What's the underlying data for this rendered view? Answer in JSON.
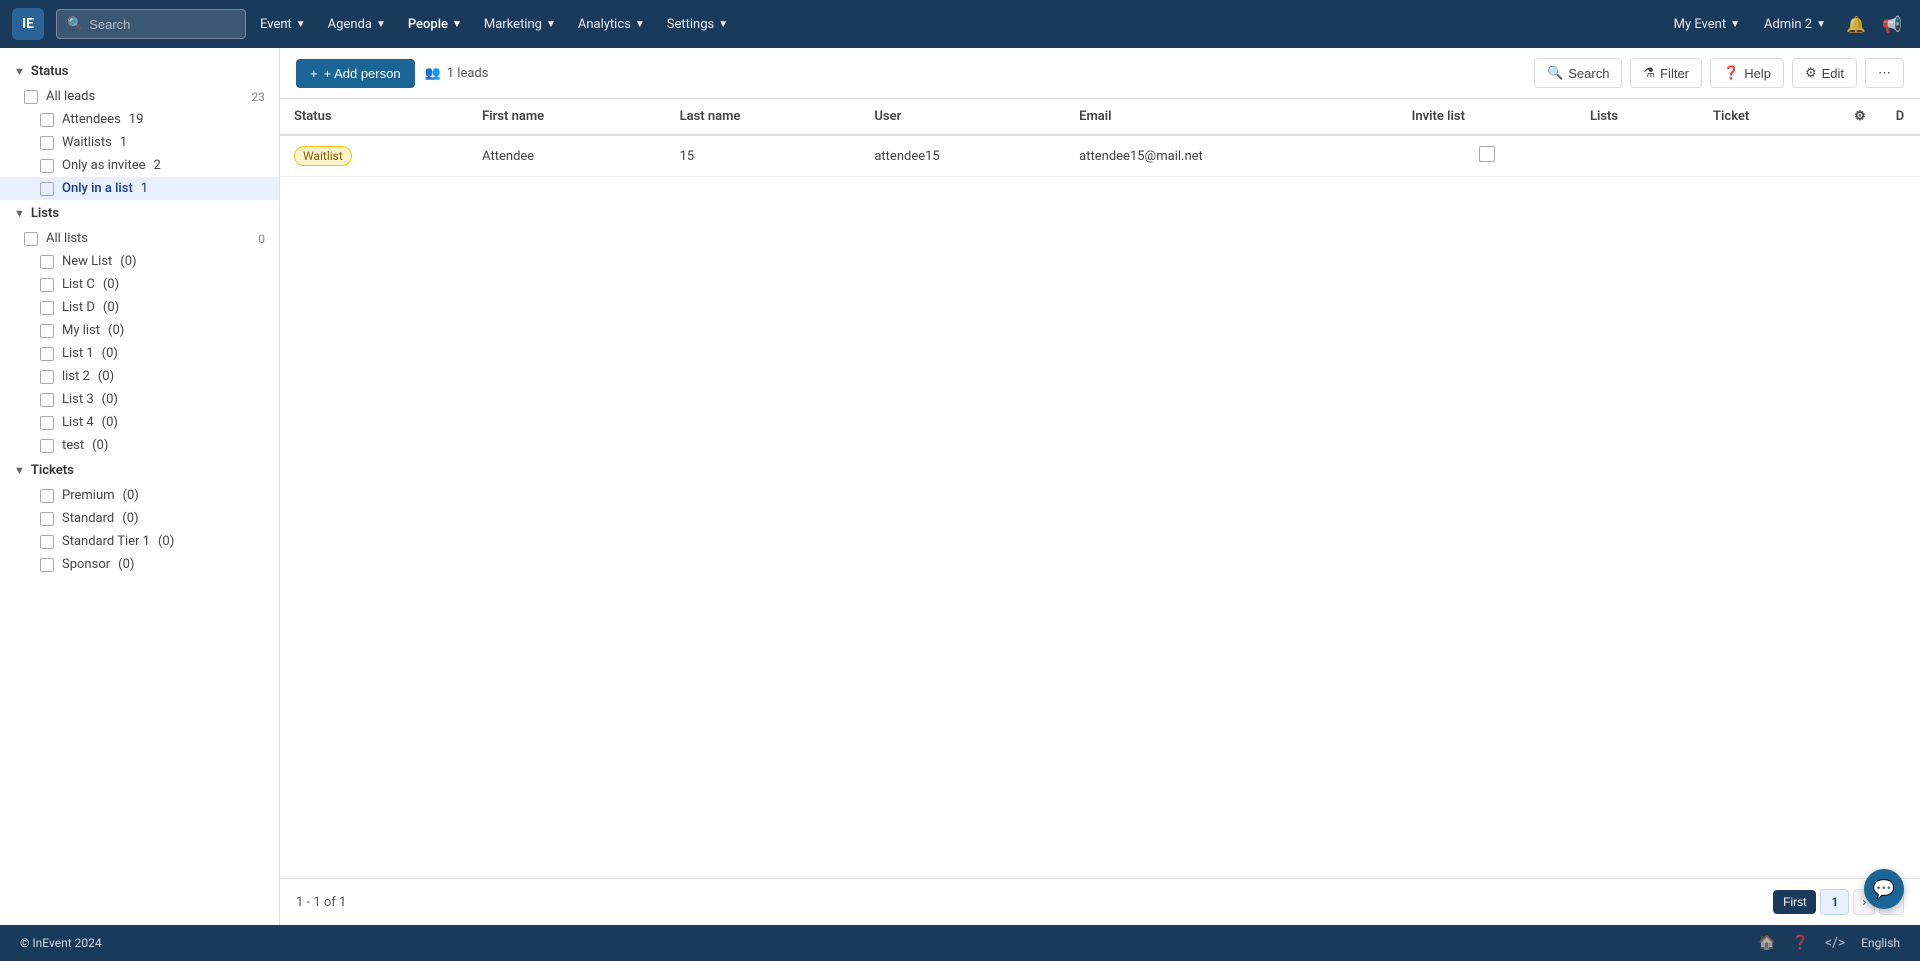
{
  "navbar": {
    "logo_text": "IE",
    "search_placeholder": "Search",
    "nav_items": [
      {
        "label": "Event",
        "has_dropdown": true
      },
      {
        "label": "Agenda",
        "has_dropdown": true
      },
      {
        "label": "People",
        "has_dropdown": true,
        "active": true
      },
      {
        "label": "Marketing",
        "has_dropdown": true
      },
      {
        "label": "Analytics",
        "has_dropdown": true
      },
      {
        "label": "Settings",
        "has_dropdown": true
      }
    ],
    "my_event_label": "My Event",
    "admin_label": "Admin 2"
  },
  "toolbar": {
    "add_person_label": "+ Add person",
    "leads_count_label": "1 leads",
    "search_label": "Search",
    "filter_label": "Filter",
    "help_label": "Help",
    "edit_label": "Edit"
  },
  "table": {
    "columns": [
      "Status",
      "First name",
      "Last name",
      "User",
      "Email",
      "Invite list",
      "Lists",
      "Ticket"
    ],
    "rows": [
      {
        "status": "Waitlist",
        "first_name": "Attendee",
        "last_name": "15",
        "user": "attendee15",
        "email": "attendee15@mail.net",
        "invite_list": false,
        "lists": "",
        "ticket": ""
      }
    ]
  },
  "sidebar": {
    "sections": [
      {
        "label": "Status",
        "expanded": true,
        "items": [
          {
            "label": "All leads",
            "count": "23",
            "level": 1
          },
          {
            "label": "Attendees",
            "count": "19",
            "level": 2
          },
          {
            "label": "Waitlists",
            "count": "1",
            "level": 2
          },
          {
            "label": "Only as invitee",
            "count": "2",
            "level": 2
          },
          {
            "label": "Only in a list",
            "count": "1",
            "level": 2,
            "selected": true
          }
        ]
      },
      {
        "label": "Lists",
        "expanded": true,
        "items": [
          {
            "label": "All lists",
            "count": "0",
            "level": 1
          },
          {
            "label": "New List",
            "count": "(0)",
            "level": 2
          },
          {
            "label": "List C",
            "count": "(0)",
            "level": 2
          },
          {
            "label": "List D",
            "count": "(0)",
            "level": 2
          },
          {
            "label": "My list",
            "count": "(0)",
            "level": 2
          },
          {
            "label": "List 1",
            "count": "(0)",
            "level": 2
          },
          {
            "label": "list 2",
            "count": "(0)",
            "level": 2
          },
          {
            "label": "List 3",
            "count": "(0)",
            "level": 2
          },
          {
            "label": "List 4",
            "count": "(0)",
            "level": 2
          },
          {
            "label": "test",
            "count": "(0)",
            "level": 2
          }
        ]
      },
      {
        "label": "Tickets",
        "expanded": true,
        "items": [
          {
            "label": "Premium",
            "count": "(0)",
            "level": 2
          },
          {
            "label": "Standard",
            "count": "(0)",
            "level": 2
          },
          {
            "label": "Standard Tier 1",
            "count": "(0)",
            "level": 2
          },
          {
            "label": "Sponsor",
            "count": "(0)",
            "level": 2
          }
        ]
      }
    ]
  },
  "pagination": {
    "info": "1 - 1 of 1",
    "first_label": "First",
    "page_number": "1",
    "next_label": "›",
    "last_label": "»"
  },
  "footer": {
    "copyright": "© InEvent 2024",
    "language": "English"
  }
}
